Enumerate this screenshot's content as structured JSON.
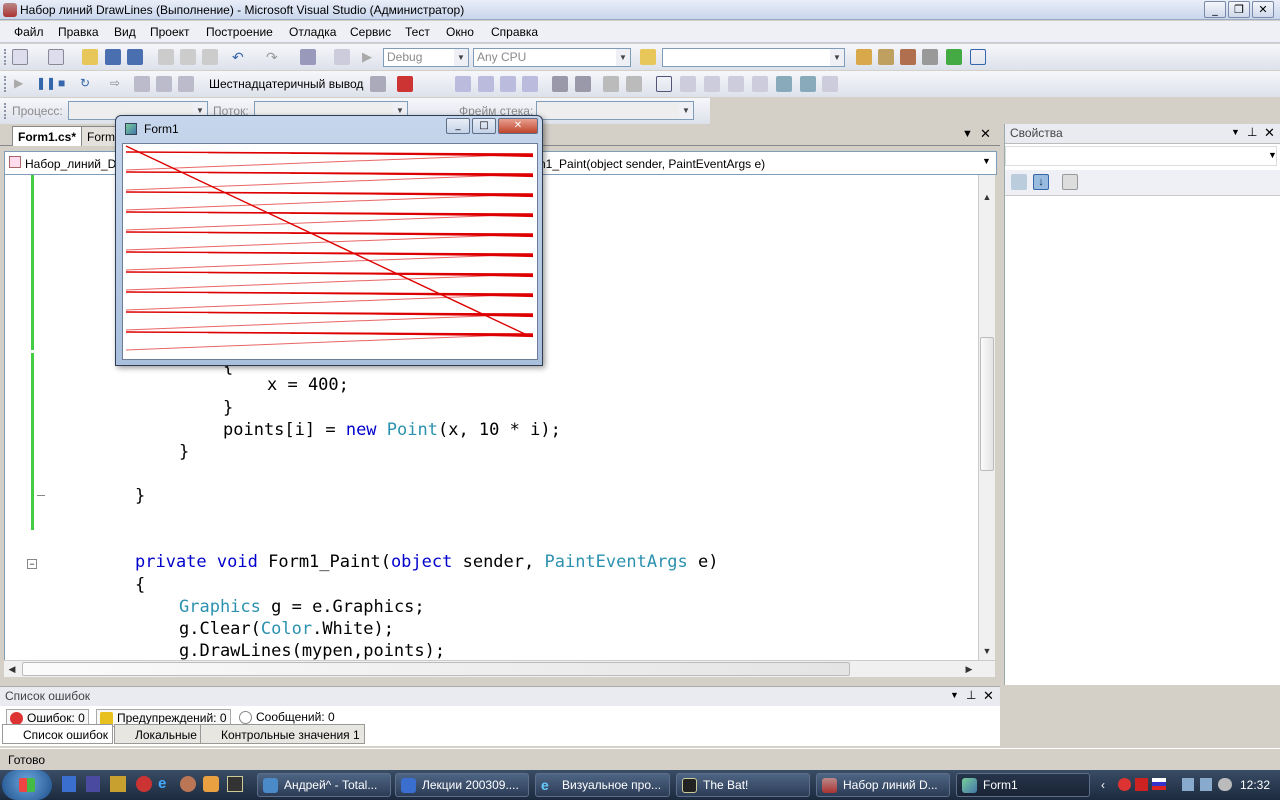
{
  "window": {
    "title": "Набор линий DrawLines (Выполнение) - Microsoft Visual Studio (Администратор)",
    "min_glyph": "0",
    "max_glyph": "1",
    "close_glyph": "r"
  },
  "menu": [
    "Файл",
    "Правка",
    "Вид",
    "Проект",
    "Построение",
    "Отладка",
    "Сервис",
    "Тест",
    "Окно",
    "Справка"
  ],
  "toolbar1": {
    "config": "Debug",
    "platform": "Any CPU",
    "search": ""
  },
  "toolbar2": {
    "hex_label": "Шестнадцатеричный вывод"
  },
  "toolbar3": {
    "process_label": "Процесс:",
    "thread_label": "Поток:",
    "frame_label": "Фрейм стека:"
  },
  "tabs": [
    {
      "label": "Form1.cs*",
      "active": true
    },
    {
      "label": "Form",
      "active": false
    }
  ],
  "nav": {
    "left": "Набор_линий_D",
    "right": "n1_Paint(object sender, PaintEventArgs e)"
  },
  "code": {
    "l0": "{",
    "l1": "x = 400;",
    "l2": "}",
    "l3_a": "points[i] = ",
    "l3_kw": "new",
    "l3_ty": "Point",
    "l3_b": "(x, 10 * i);",
    "l4": "}",
    "l5": "}",
    "l6_kw1": "private",
    "l6_kw2": "void",
    "l6_a": "Form1_Paint(",
    "l6_kw3": "object",
    "l6_b": " sender, ",
    "l6_ty": "PaintEventArgs",
    "l6_c": " e)",
    "l7": "{",
    "l8_ty": "Graphics",
    "l8_a": " g = e.Graphics;",
    "l9_a": "g.Clear(",
    "l9_ty": "Color",
    "l9_b": ".White);",
    "l10": "g.DrawLines(mypen,points);"
  },
  "form1": {
    "title": "Form1",
    "pen_color": "#dd0000"
  },
  "properties": {
    "title": "Свойства"
  },
  "error_list": {
    "title": "Список ошибок",
    "errors": "Ошибок: 0",
    "warnings": "Предупреждений: 0",
    "messages": "Сообщений: 0"
  },
  "bottom_tabs": [
    "Список ошибок",
    "Локальные",
    "Контрольные значения 1"
  ],
  "status": "Готово",
  "taskbar": {
    "tasks": [
      "Андрей^ - Total...",
      "Лекции 200309....",
      "Визуальное про...",
      "The Bat!",
      "Набор линий D...",
      "Form1"
    ],
    "clock": "12:32"
  }
}
